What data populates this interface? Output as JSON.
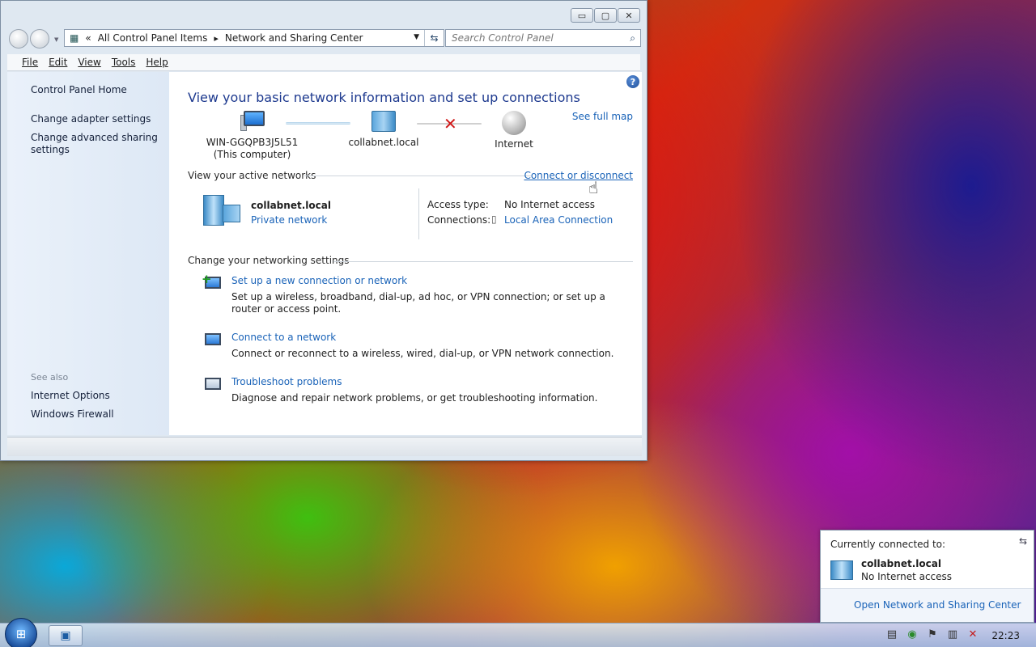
{
  "window": {
    "caption_buttons": {
      "minimize": "▭",
      "maximize": "▢",
      "close": "✕"
    }
  },
  "address_bar": {
    "overflow": "«",
    "crumbs": [
      "All Control Panel Items",
      "Network and Sharing Center"
    ],
    "separator": "▸"
  },
  "search": {
    "placeholder": "Search Control Panel"
  },
  "menu": [
    "File",
    "Edit",
    "View",
    "Tools",
    "Help"
  ],
  "sidebar": {
    "home": "Control Panel Home",
    "links": [
      "Change adapter settings",
      "Change advanced sharing settings"
    ],
    "see_also_label": "See also",
    "see_also": [
      "Internet Options",
      "Windows Firewall"
    ]
  },
  "main": {
    "title": "View your basic network information and set up connections",
    "see_full_map": "See full map",
    "map": {
      "computer_name": "WIN-GGQPB3J5L51",
      "computer_sub": "(This computer)",
      "network": "collabnet.local",
      "internet": "Internet"
    },
    "active_networks_header": "View your active networks",
    "connect_or_disconnect": "Connect or disconnect",
    "active_network": {
      "name": "collabnet.local",
      "type": "Private network",
      "access_label": "Access type:",
      "access_value": "No Internet access",
      "connections_label": "Connections:",
      "connections_value": "Local Area Connection"
    },
    "change_settings_header": "Change your networking settings",
    "tasks": [
      {
        "link": "Set up a new connection or network",
        "desc": "Set up a wireless, broadband, dial-up, ad hoc, or VPN connection; or set up a router or access point."
      },
      {
        "link": "Connect to a network",
        "desc": "Connect or reconnect to a wireless, wired, dial-up, or VPN network connection."
      },
      {
        "link": "Troubleshoot problems",
        "desc": "Diagnose and repair network problems, or get troubleshooting information."
      }
    ]
  },
  "flyout": {
    "header": "Currently connected to:",
    "network": "collabnet.local",
    "status": "No Internet access",
    "open_link": "Open Network and Sharing Center"
  },
  "taskbar": {
    "clock": "22:23"
  },
  "colors": {
    "link": "#1a63b8",
    "title": "#1e3a8f"
  }
}
